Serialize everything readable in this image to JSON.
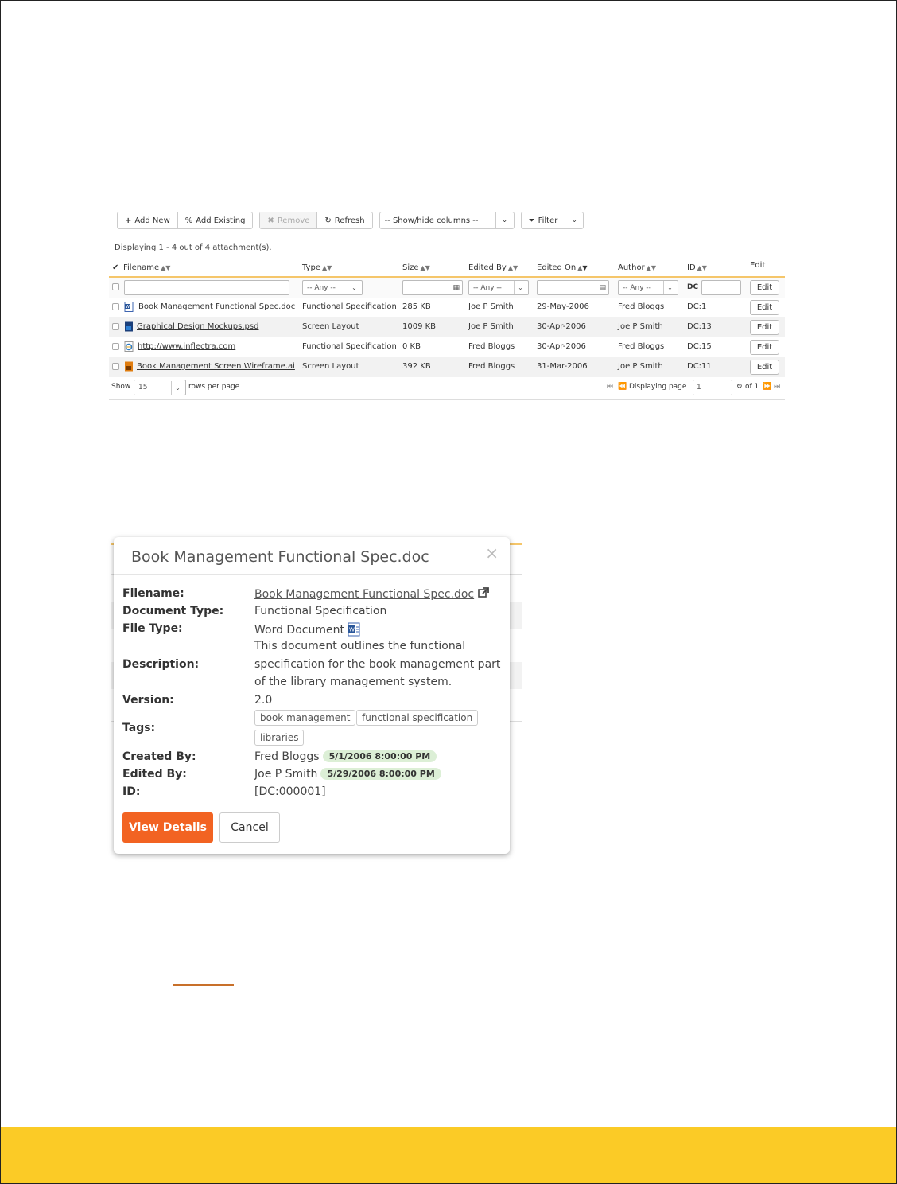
{
  "colors": {
    "footer": "#fbcb26",
    "accent": "#f26322",
    "stamp": "#dcefd6"
  },
  "toolbar": {
    "add_new": "Add New",
    "add_existing": "Add Existing",
    "remove": "Remove",
    "refresh": "Refresh",
    "show_hide": "-- Show/hide columns --",
    "filter": "Filter"
  },
  "grid": {
    "displaying": "Displaying 1 - 4 out of 4 attachment(s).",
    "columns": [
      "Filename",
      "Type",
      "Size",
      "Edited By",
      "Edited On",
      "Author",
      "ID",
      "Edit"
    ],
    "filters": {
      "any": "-- Any --",
      "id_prefix": "DC",
      "edit": "Edit"
    },
    "rows": [
      {
        "icon": "word-doc-icon",
        "filename": "Book Management Functional Spec.doc",
        "type": "Functional Specification",
        "size": "285 KB",
        "edited_by": "Joe P Smith",
        "edited_on": "29-May-2006",
        "author": "Fred Bloggs",
        "id": "DC:1",
        "edit": "Edit"
      },
      {
        "icon": "photoshop-file-icon",
        "filename": "Graphical Design Mockups.psd",
        "type": "Screen Layout",
        "size": "1009 KB",
        "edited_by": "Joe P Smith",
        "edited_on": "30-Apr-2006",
        "author": "Joe P Smith",
        "id": "DC:13",
        "edit": "Edit"
      },
      {
        "icon": "web-link-icon",
        "filename": "http://www.inflectra.com",
        "type": "Functional Specification",
        "size": "0 KB",
        "edited_by": "Fred Bloggs",
        "edited_on": "30-Apr-2006",
        "author": "Fred Bloggs",
        "id": "DC:15",
        "edit": "Edit"
      },
      {
        "icon": "illustrator-file-icon",
        "filename": "Book Management Screen Wireframe.ai",
        "type": "Screen Layout",
        "size": "392 KB",
        "edited_by": "Fred Bloggs",
        "edited_on": "31-Mar-2006",
        "author": "Joe P Smith",
        "id": "DC:11",
        "edit": "Edit"
      }
    ],
    "pager": {
      "show": "Show",
      "rows_value": "15",
      "rows_per_page": "rows per page",
      "displaying_page": "Displaying page",
      "page_value": "1",
      "of": "of 1"
    }
  },
  "popup": {
    "title": "Book Management Functional Spec.doc",
    "close": "×",
    "labels": {
      "filename": "Filename:",
      "document_type": "Document Type:",
      "file_type": "File Type:",
      "description": "Description:",
      "version": "Version:",
      "tags": "Tags:",
      "created_by": "Created By:",
      "edited_by": "Edited By:",
      "id": "ID:"
    },
    "values": {
      "filename": "Book Management Functional Spec.doc",
      "document_type": "Functional Specification",
      "file_type": "Word Document",
      "description_lines": [
        "This document outlines the functional",
        "specification for the book management part",
        "of the library management system."
      ],
      "version": "2.0",
      "tags": [
        "book management",
        "functional specification",
        "libraries"
      ],
      "created_by": "Fred Bloggs",
      "created_on": "5/1/2006 8:00:00 PM",
      "edited_by": "Joe P Smith",
      "edited_on": "5/29/2006 8:00:00 PM",
      "id": "[DC:000001]"
    },
    "view_details": "View Details",
    "cancel": "Cancel"
  }
}
